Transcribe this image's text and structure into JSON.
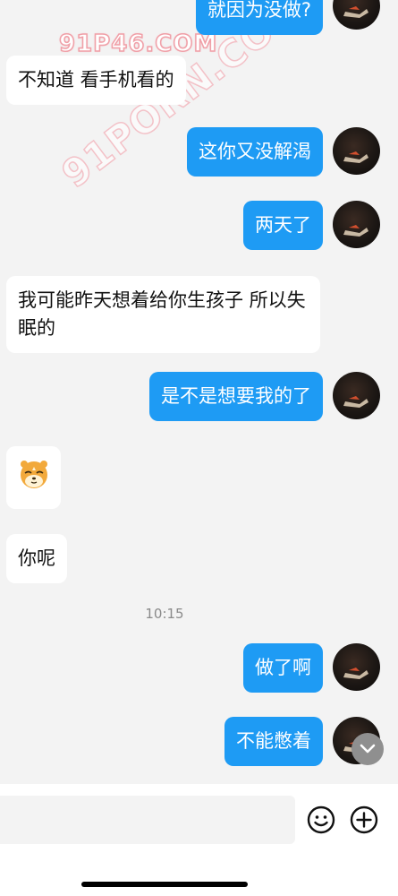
{
  "watermarks": {
    "top": "91P46.COM",
    "diagonal": "91PORN.COM"
  },
  "messages": [
    {
      "id": "m0",
      "side": "out",
      "text": "就因为没做?"
    },
    {
      "id": "m1",
      "side": "in",
      "text": "不知道 看手机看的"
    },
    {
      "id": "m2",
      "side": "out",
      "text": "这你又没解渴"
    },
    {
      "id": "m3",
      "side": "out",
      "text": "两天了"
    },
    {
      "id": "m4",
      "side": "in",
      "text": "我可能昨天想着给你生孩子 所以失眠的"
    },
    {
      "id": "m5",
      "side": "out",
      "text": "是不是想要我的了"
    },
    {
      "id": "m6",
      "side": "in",
      "sticker": "hamster-sticker-icon"
    },
    {
      "id": "m7",
      "side": "in",
      "text": "你呢"
    },
    {
      "id": "m8",
      "side": "out",
      "text": "做了啊"
    },
    {
      "id": "m9",
      "side": "out",
      "text": "不能憋着"
    }
  ],
  "timestamp": "10:15",
  "composer": {
    "placeholder": "",
    "emoji_icon": "smiley-icon",
    "plus_icon": "plus-circle-icon"
  },
  "scroll_button_icon": "chevron-down-icon",
  "colors": {
    "background": "#f3f3f3",
    "outgoing_bubble": "#1e9bf4",
    "incoming_bubble": "#ffffff",
    "outgoing_text": "#ffffff",
    "incoming_text": "#111111",
    "timestamp": "#8a8a8a"
  }
}
